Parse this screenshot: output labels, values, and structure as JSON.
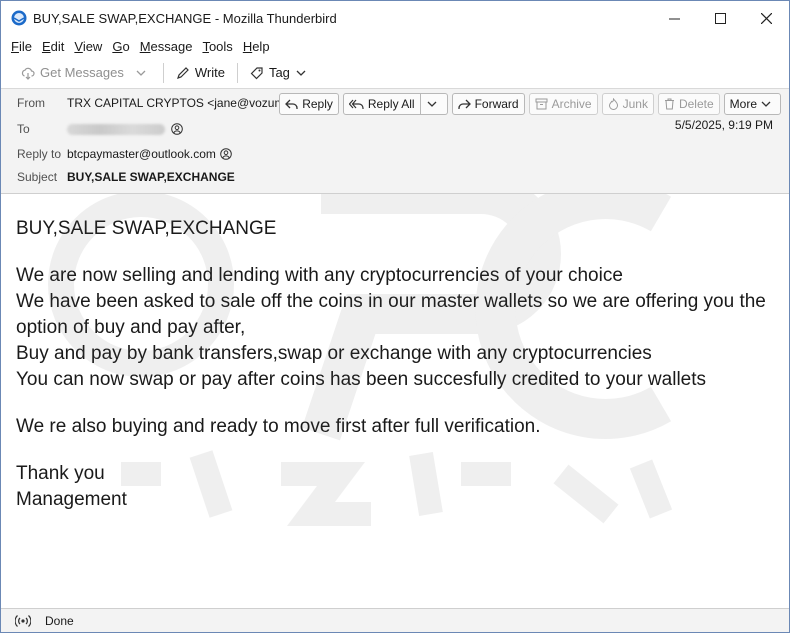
{
  "window": {
    "title": "BUY,SALE SWAP,EXCHANGE - Mozilla Thunderbird"
  },
  "menu": [
    {
      "label": "File",
      "u": "F",
      "rest": "ile"
    },
    {
      "label": "Edit",
      "u": "E",
      "rest": "dit"
    },
    {
      "label": "View",
      "u": "V",
      "rest": "iew"
    },
    {
      "label": "Go",
      "u": "G",
      "rest": "o"
    },
    {
      "label": "Message",
      "u": "M",
      "rest": "essage"
    },
    {
      "label": "Tools",
      "u": "T",
      "rest": "ools"
    },
    {
      "label": "Help",
      "u": "H",
      "rest": "elp"
    }
  ],
  "toolbar": {
    "get_messages": "Get Messages",
    "write": "Write",
    "tag": "Tag"
  },
  "header": {
    "from_label": "From",
    "from_value": "TRX CAPITAL CRYPTOS <jane@vozum.com>",
    "to_label": "To",
    "reply_to_label": "Reply to",
    "reply_to_value": "btcpaymaster@outlook.com",
    "subject_label": "Subject",
    "subject_value": "BUY,SALE SWAP,EXCHANGE",
    "date": "5/5/2025, 9:19 PM",
    "buttons": {
      "reply": "Reply",
      "reply_all": "Reply All",
      "forward": "Forward",
      "archive": "Archive",
      "junk": "Junk",
      "delete": "Delete",
      "more": "More"
    }
  },
  "body": {
    "heading": "BUY,SALE SWAP,EXCHANGE",
    "para1": [
      "We are now selling and lending with any cryptocurrencies of your choice",
      "We have been asked to sale off the coins in our master wallets so we are offering you the option of buy and pay after,",
      "Buy and pay by bank transfers,swap or exchange with any cryptocurrencies",
      "You can now swap or pay after coins has been succesfully credited to your wallets"
    ],
    "para2": "We re also buying and ready to move first after full verification.",
    "closing1": "Thank you",
    "closing2": "Management"
  },
  "status": {
    "text": "Done"
  },
  "colors": {
    "accent": "#1f4e8c",
    "header_bg": "#f3f3f3"
  }
}
